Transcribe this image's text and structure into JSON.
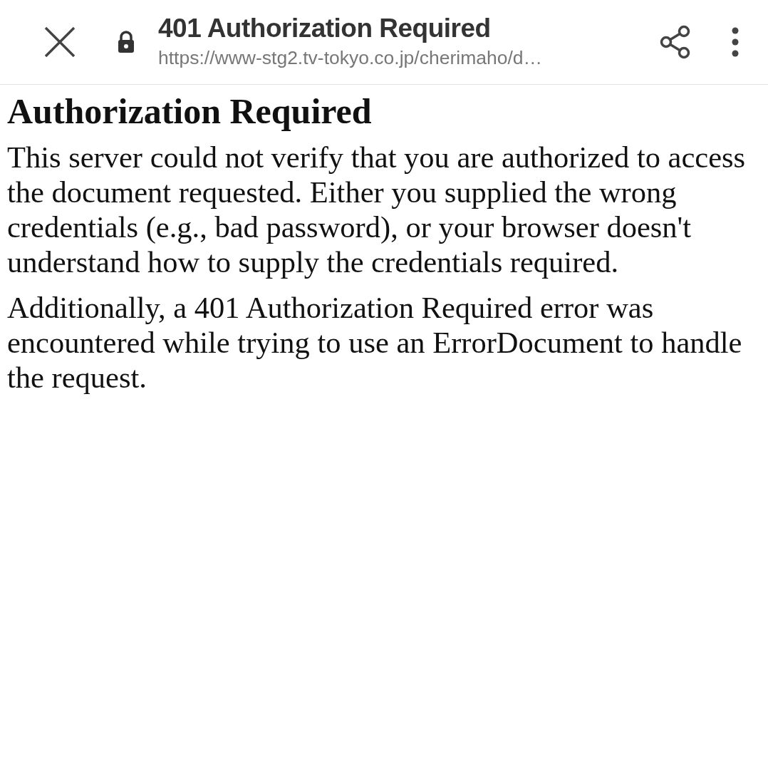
{
  "toolbar": {
    "title": "401 Authorization Required",
    "url": "https://www-stg2.tv-tokyo.co.jp/cherimaho/d…",
    "secure": true
  },
  "page": {
    "heading": "Authorization Required",
    "paragraphs": [
      "This server could not verify that you are authorized to access the document requested. Either you supplied the wrong credentials (e.g., bad password), or your browser doesn't understand how to supply the credentials required.",
      "Additionally, a 401 Authorization Required error was encountered while trying to use an ErrorDocument to handle the request."
    ]
  }
}
